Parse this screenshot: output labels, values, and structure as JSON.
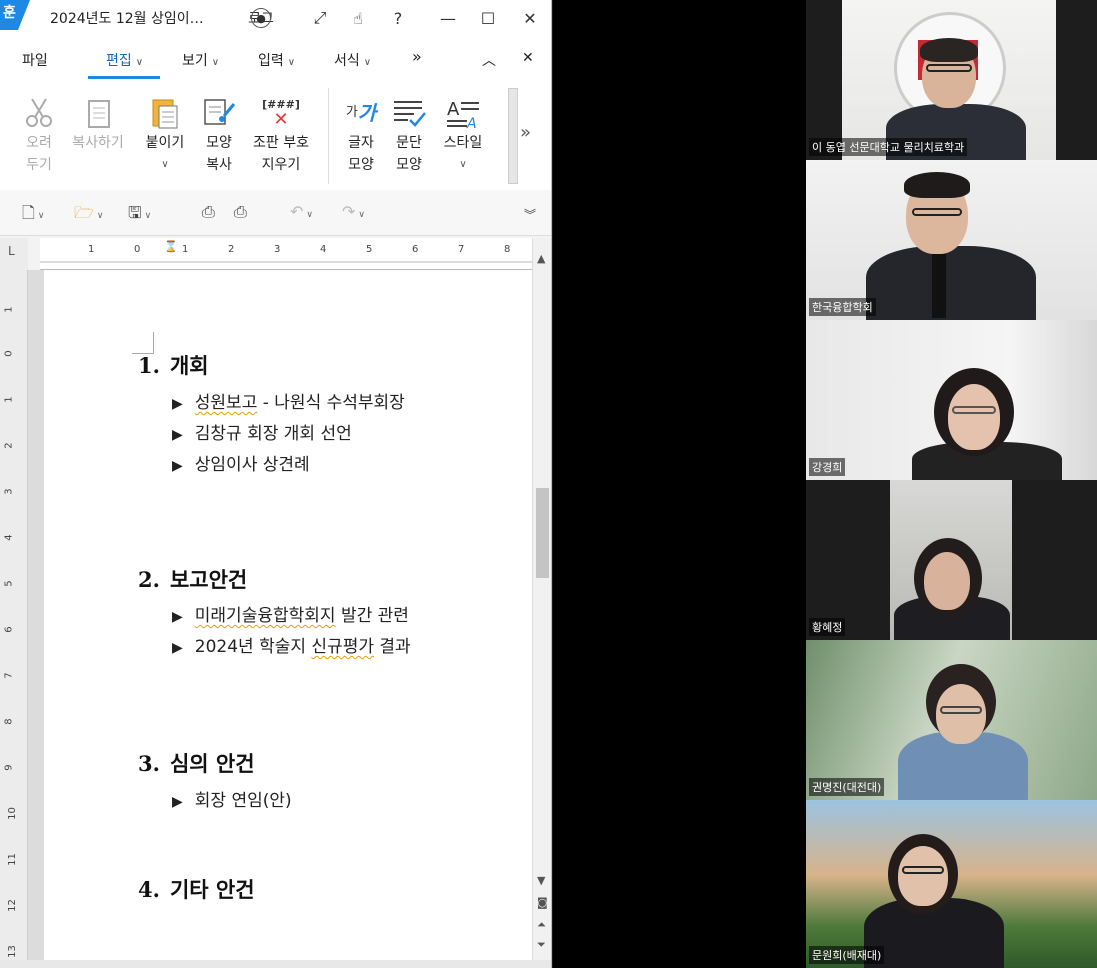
{
  "window": {
    "app_logo": "훈",
    "title": "2024년도 12월 상임이…",
    "login_label": "로그",
    "controls": {
      "expand": "⤢",
      "hand": "☝",
      "help": "?",
      "minimize": "—",
      "maximize": "☐",
      "close": "✕"
    }
  },
  "menu": {
    "items": [
      {
        "label": "파일"
      },
      {
        "label": "편집"
      },
      {
        "label": "보기"
      },
      {
        "label": "입력"
      },
      {
        "label": "서식"
      }
    ],
    "more": "»",
    "collapse": "︿",
    "close": "✕",
    "active_color": "#1565c0"
  },
  "ribbon": {
    "buttons": [
      {
        "label": "오려\n두기",
        "l1": "오려",
        "l2": "두기"
      },
      {
        "label": "복사하기"
      },
      {
        "label": "붙이기"
      },
      {
        "l1": "모양",
        "l2": "복사"
      },
      {
        "l1": "조판 부호",
        "l2": "지우기"
      },
      {
        "l1": "글자",
        "l2": "모양"
      },
      {
        "l1": "문단",
        "l2": "모양"
      },
      {
        "label": "스타일"
      }
    ],
    "icon_text": {
      "code": "[###]",
      "char": "가",
      "char_sub": "가",
      "style": "A"
    },
    "more": "»"
  },
  "ruler": {
    "corner": "L",
    "h_ticks": [
      "1",
      "0",
      "1",
      "2",
      "3",
      "4",
      "5",
      "6",
      "7",
      "8"
    ],
    "v_ticks": [
      "1",
      "0",
      "1",
      "2",
      "3",
      "4",
      "5",
      "6",
      "7",
      "8",
      "9",
      "10",
      "11",
      "12",
      "13"
    ]
  },
  "document": {
    "sections": [
      {
        "num": "1.",
        "title": "개회",
        "items": [
          {
            "pre": "",
            "mark": "성원보고",
            "post": " - 나원식 수석부회장"
          },
          {
            "pre": "김창규 회장 개회 선언",
            "mark": "",
            "post": ""
          },
          {
            "pre": "상임이사 상견례",
            "mark": "",
            "post": ""
          }
        ]
      },
      {
        "num": "2.",
        "title": "보고안건",
        "items": [
          {
            "pre": "",
            "mark": "미래기술융합학회지",
            "post": " 발간 관련"
          },
          {
            "pre": "2024년 학술지 ",
            "mark": "신규평가",
            "post": " 결과"
          }
        ]
      },
      {
        "num": "3.",
        "title": "심의 안건",
        "items": [
          {
            "pre": "회장 연임(안)",
            "mark": "",
            "post": ""
          }
        ]
      },
      {
        "num": "4.",
        "title": "기타 안건",
        "items": []
      }
    ],
    "bullet": "▶"
  },
  "participants": [
    {
      "name": "이 동엽 선문대학교 물리치료학과"
    },
    {
      "name": "한국융합학회"
    },
    {
      "name": "강경희"
    },
    {
      "name": "황혜정"
    },
    {
      "name": "권명진(대전대)"
    },
    {
      "name": "문원희(배재대)"
    }
  ]
}
